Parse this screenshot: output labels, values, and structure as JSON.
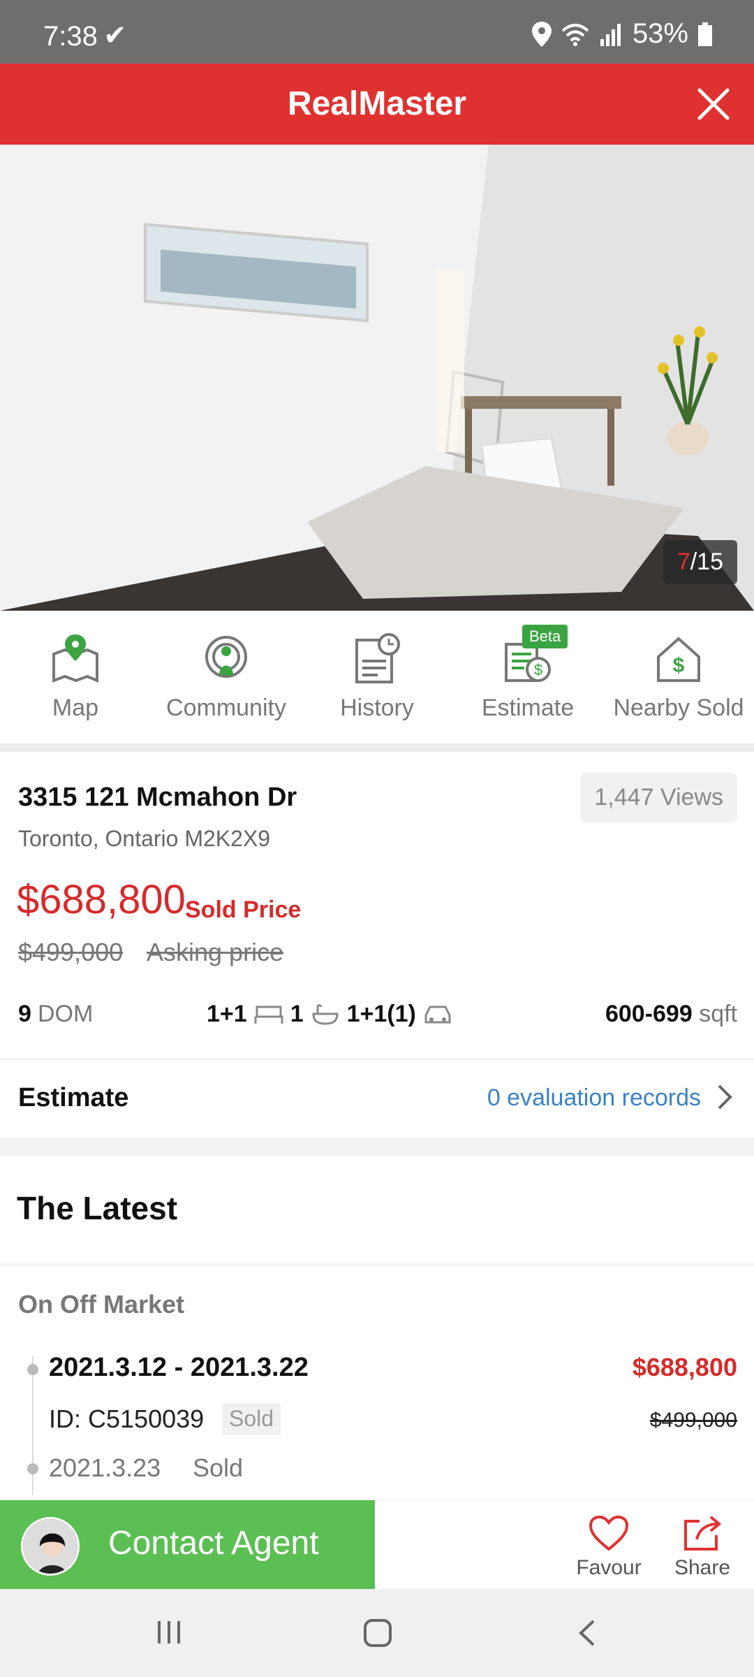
{
  "status": {
    "time": "7:38",
    "battery": "53%"
  },
  "app": {
    "title": "RealMaster"
  },
  "gallery": {
    "current": "7",
    "total": "/15"
  },
  "quicknav": [
    {
      "label": "Map"
    },
    {
      "label": "Community"
    },
    {
      "label": "History"
    },
    {
      "label": "Estimate"
    },
    {
      "label": "Nearby Sold"
    }
  ],
  "beta_badge": "Beta",
  "listing": {
    "address": "3315 121 Mcmahon Dr",
    "city": "Toronto, Ontario M2K2X9",
    "views": "1,447 Views",
    "price": "$688,800",
    "price_label": "Sold Price",
    "asking": "$499,000",
    "asking_label": "Asking price",
    "dom_value": "9",
    "dom_label": "DOM",
    "beds": "1+1",
    "baths": "1",
    "parking": "1+1(1)",
    "sqft_value": "600-699",
    "sqft_label": "sqft"
  },
  "estimate": {
    "title": "Estimate",
    "records": "0 evaluation records"
  },
  "latest": {
    "title": "The Latest",
    "section": "On Off Market",
    "period": "2021.3.12 - 2021.3.22",
    "price": "$688,800",
    "mls_id": "ID: C5150039",
    "status_tag": "Sold",
    "asking": "$499,000",
    "sold_date": "2021.3.23",
    "sold_status": "Sold"
  },
  "actions": {
    "contact": "Contact Agent",
    "favour": "Favour",
    "share": "Share"
  },
  "colors": {
    "brand": "#e03131",
    "green": "#5cbf54",
    "link": "#3b82c4"
  }
}
